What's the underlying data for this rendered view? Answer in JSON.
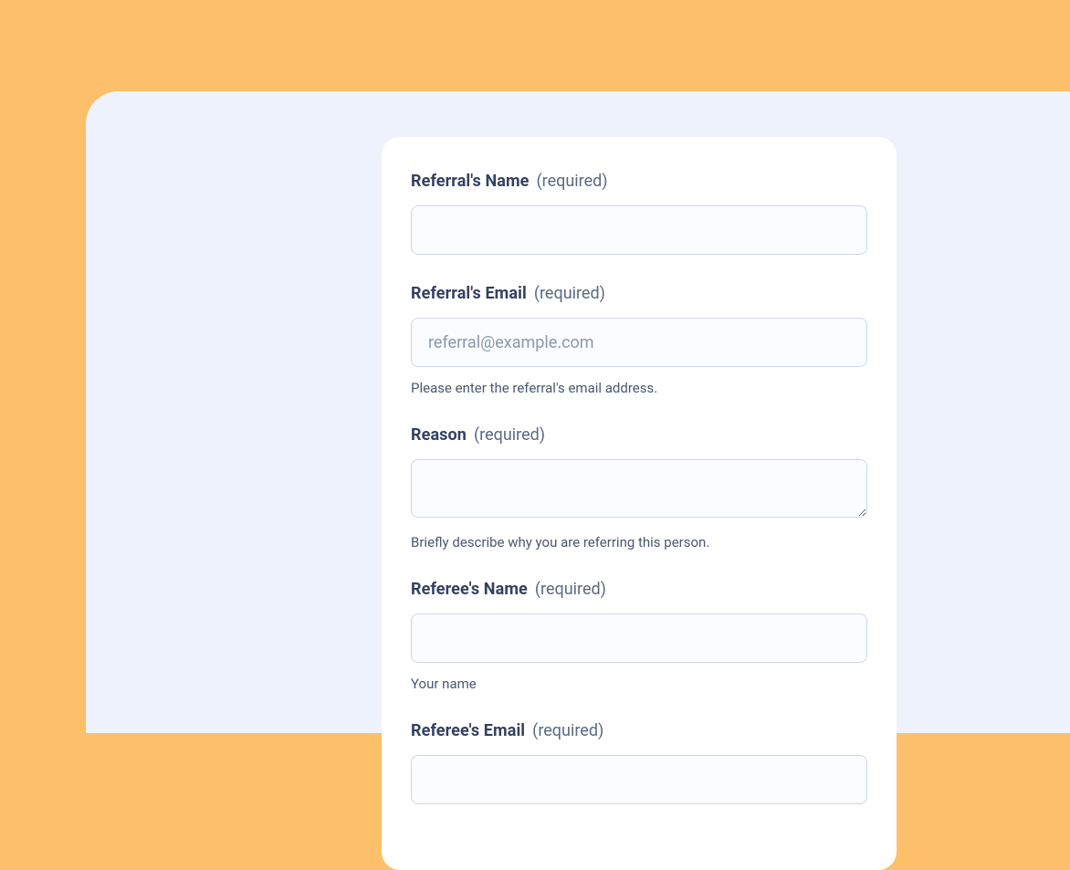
{
  "form": {
    "required_suffix": "(required)",
    "fields": {
      "referral_name": {
        "label": "Referral's Name",
        "placeholder": "",
        "help": ""
      },
      "referral_email": {
        "label": "Referral's Email",
        "placeholder": "referral@example.com",
        "help": "Please enter the referral's email address."
      },
      "reason": {
        "label": "Reason",
        "placeholder": "",
        "help": "Briefly describe why you are referring this person."
      },
      "referee_name": {
        "label": "Referee's Name",
        "placeholder": "",
        "help": "Your name"
      },
      "referee_email": {
        "label": "Referee's Email",
        "placeholder": "",
        "help": ""
      }
    }
  }
}
